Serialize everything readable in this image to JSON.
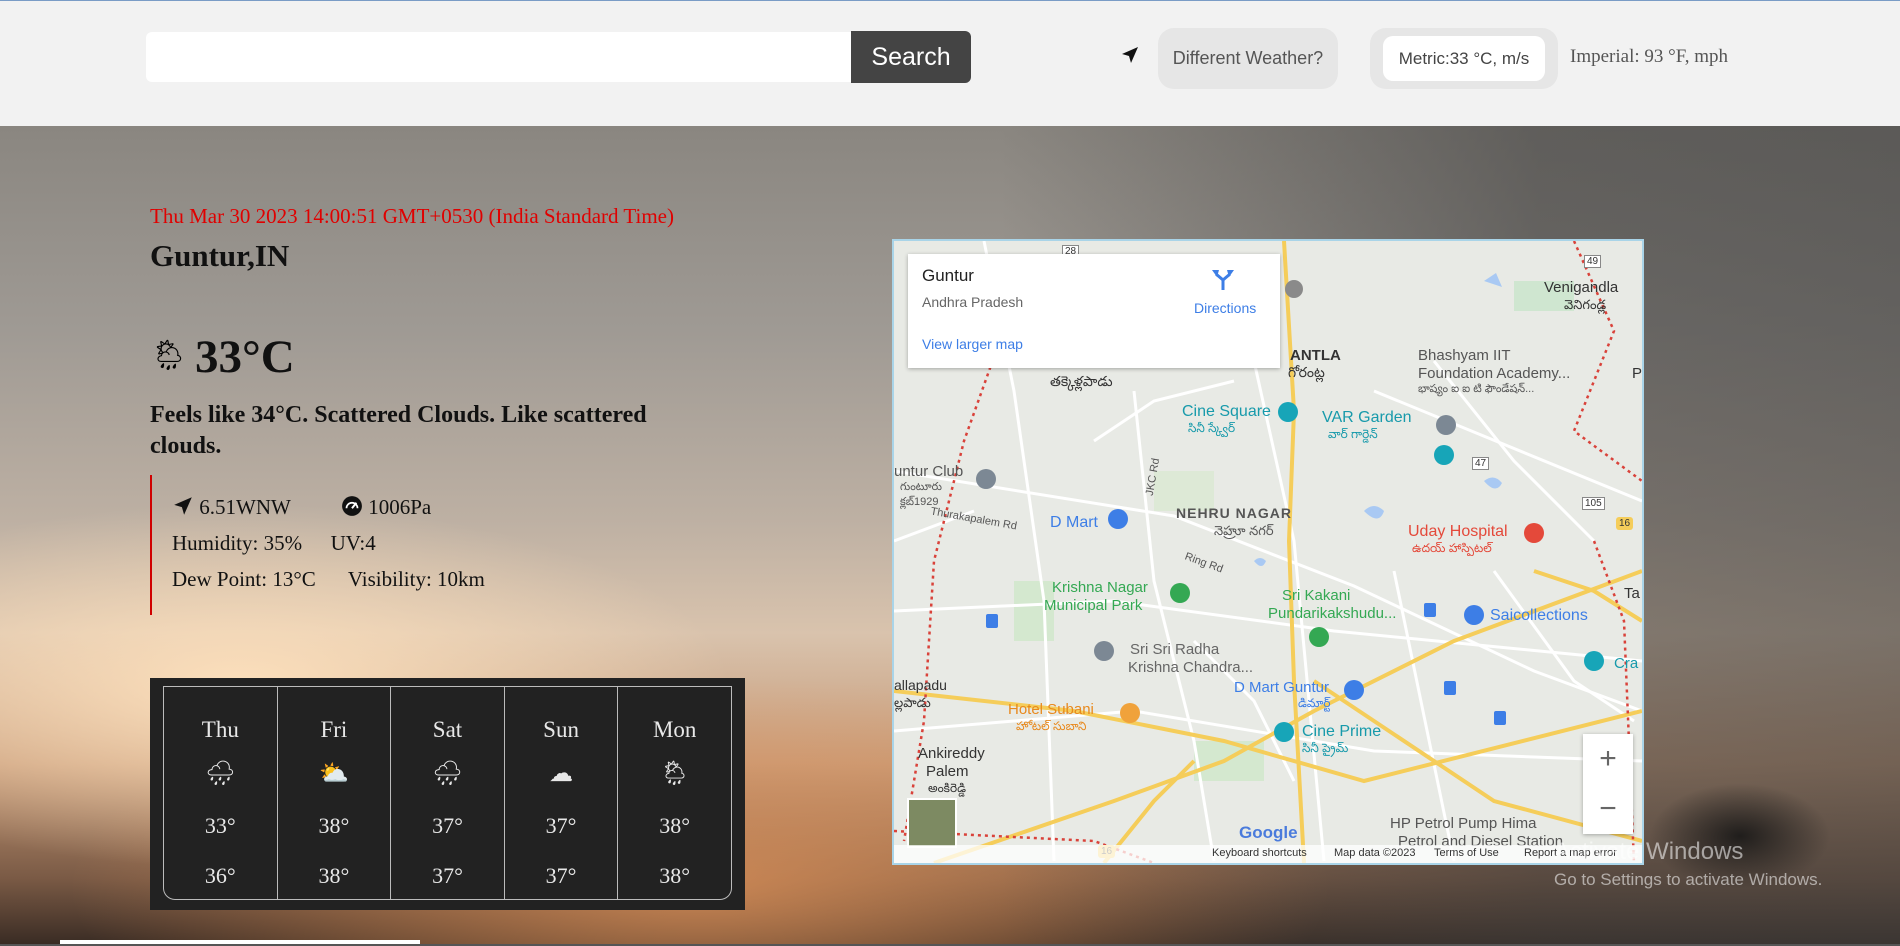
{
  "topbar": {
    "search_value": "",
    "search_label": "Search",
    "location_icon": "navigation-arrow-icon",
    "different_weather_label": "Different Weather?",
    "metric_label": "Metric:33 °C, m/s",
    "imperial_label": "Imperial: 93 °F, mph"
  },
  "current": {
    "datetime": "Thu Mar 30 2023 14:00:51 GMT+0530 (India Standard Time)",
    "city": "Guntur,IN",
    "icon": "sun-behind-rain-cloud-icon",
    "temperature": "33°C",
    "feels_like": "Feels like 34°C. Scattered Clouds. Like scattered clouds.",
    "wind": "6.51WNW",
    "pressure": "1006Pa",
    "humidity": "Humidity: 35%",
    "uv": "UV:4",
    "dew_point": "Dew Point: 13°C",
    "visibility": "Visibility: 10km"
  },
  "forecast": [
    {
      "day": "Thu",
      "icon": "rain-icon",
      "hi": "33°",
      "lo": "36°"
    },
    {
      "day": "Fri",
      "icon": "sun-behind-cloud-icon",
      "hi": "38°",
      "lo": "38°"
    },
    {
      "day": "Sat",
      "icon": "rain-cloud-icon",
      "hi": "37°",
      "lo": "37°"
    },
    {
      "day": "Sun",
      "icon": "cloud-icon",
      "hi": "37°",
      "lo": "37°"
    },
    {
      "day": "Mon",
      "icon": "sun-rain-icon",
      "hi": "38°",
      "lo": "38°"
    }
  ],
  "map": {
    "place_title": "Guntur",
    "place_subtitle": "Andhra Pradesh",
    "directions_label": "Directions",
    "larger_map_label": "View larger map",
    "zoom_in": "+",
    "zoom_out": "−",
    "google": "Google",
    "footer": {
      "shortcuts": "Keyboard shortcuts",
      "data": "Map data ©2023",
      "terms": "Terms of Use",
      "report": "Report a map error"
    },
    "labels": {
      "kantla": "ANTLA",
      "kantla_te": "గోరంట్ల",
      "venigandla": "Venigandla",
      "venigandla_te": "వెనిగండ్ల",
      "bhashyam": "Bhashyam IIT",
      "bhashyam2": "Foundation Academy...",
      "bhashyam_te": "భాష్యం ఐ ఐ టి ఫౌండేషన్...",
      "cine_square": "Cine Square",
      "cine_square_te": "సినీ స్క్వేర్",
      "var_garden": "VAR Garden",
      "var_garden_te": "వార్ గార్డెన్",
      "untur_club": "untur Club",
      "untur_club_te": "గుంటూరు క్లబ్1929",
      "thurakapalem": "Thurakapalem Rd",
      "jkc": "JKC Rd",
      "dmart": "D Mart",
      "nehru_nagar": "NEHRU NAGAR",
      "nehru_nagar_te": "నెహ్రూ నగర్",
      "uday": "Uday Hospital",
      "uday_te": "ఉదయ్ హాస్పిటల్",
      "ring_rd": "Ring Rd",
      "krishna_nagar": "Krishna Nagar",
      "municipal_park": "Municipal Park",
      "sri_kakani": "Sri Kakani",
      "pundarik": "Pundarikakshudu...",
      "saicollections": "Saicollections",
      "radha": "Sri Sri Radha",
      "krishna_chandra": "Krishna Chandra...",
      "dmart_guntur": "D Mart Guntur",
      "dmart_guntur_te": "డిమార్ట్",
      "allapadu": "allapadu",
      "allapadu_te": "ల్లపాడు",
      "hotel_subani": "Hotel Subani",
      "hotel_subani_te": "హోటల్ సుబాని",
      "cine_prime": "Cine Prime",
      "cine_prime_te": "సినీ ప్రైమ్",
      "ankireddy": "Ankireddy",
      "palem": "Palem",
      "ankireddy_te": "అంకిరెడ్డి",
      "hp_petrol": "HP Petrol Pump Hima",
      "petrol_diesel": "Petrol and Diesel Station",
      "takkellapadu_te": "తక్కెళ్లపాడు",
      "ta": "Ta",
      "cra": "Cra",
      "p": "P",
      "road_28": "28",
      "road_49": "49",
      "road_47": "47",
      "road_105": "105",
      "road_16a": "16",
      "road_16b": "16"
    }
  },
  "watermark": {
    "line1": "Activate Windows",
    "line2": "Go to Settings to activate Windows."
  }
}
